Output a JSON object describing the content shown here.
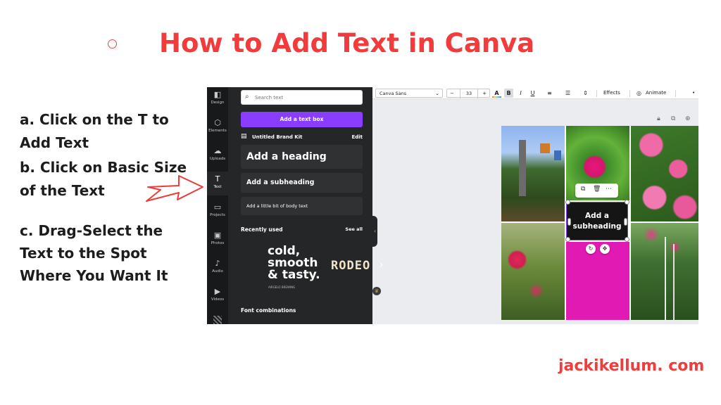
{
  "title": "How to Add Text in Canva",
  "instructions": {
    "a": "a. Click on the T to Add Text",
    "b": "b. Click on Basic Size of the Text",
    "c": "c. Drag-Select the Text to the Spot Where You Want It"
  },
  "website": "jackikellum. com",
  "canva": {
    "rail": [
      {
        "label": "Design",
        "icon": "design-icon",
        "glyph": "◧"
      },
      {
        "label": "Elements",
        "icon": "elements-icon",
        "glyph": "⬡"
      },
      {
        "label": "Uploads",
        "icon": "uploads-icon",
        "glyph": "☁"
      },
      {
        "label": "Text",
        "icon": "text-icon",
        "glyph": "T",
        "active": true
      },
      {
        "label": "Projects",
        "icon": "folder-icon",
        "glyph": "▭"
      },
      {
        "label": "Photos",
        "icon": "photos-icon",
        "glyph": "▣"
      },
      {
        "label": "Audio",
        "icon": "audio-icon",
        "glyph": "♪"
      },
      {
        "label": "Videos",
        "icon": "videos-icon",
        "glyph": "▶"
      }
    ],
    "panel": {
      "search_placeholder": "Search text",
      "add_text_box": "Add a text box",
      "brand_kit": "Untitled Brand Kit",
      "edit": "Edit",
      "heading": "Add a heading",
      "subheading": "Add a subheading",
      "body": "Add a little bit of body text",
      "recently_used": "Recently used",
      "see_all": "See all",
      "font_card_1": "cold, smooth & tasty.",
      "font_card_1_line1": "cold,",
      "font_card_1_line2": "smooth",
      "font_card_1_line3": "& tasty.",
      "font_card_1_sub": "AIRGELO BREWING",
      "font_card_2": "RODEO",
      "font_combinations": "Font combinations"
    },
    "toolbar": {
      "font": "Canva Sans",
      "size": "33",
      "minus": "−",
      "plus": "+",
      "text_color": "A",
      "bold": "B",
      "italic": "I",
      "underline": "U",
      "effects": "Effects",
      "animate": "Animate",
      "more": "•"
    },
    "canvas": {
      "selected_text": "Add a subheading"
    },
    "colors": {
      "accent": "#8b3dff",
      "title_red": "#f23b3b",
      "panel_bg": "#252627",
      "magenta": "#e11ab4"
    }
  }
}
